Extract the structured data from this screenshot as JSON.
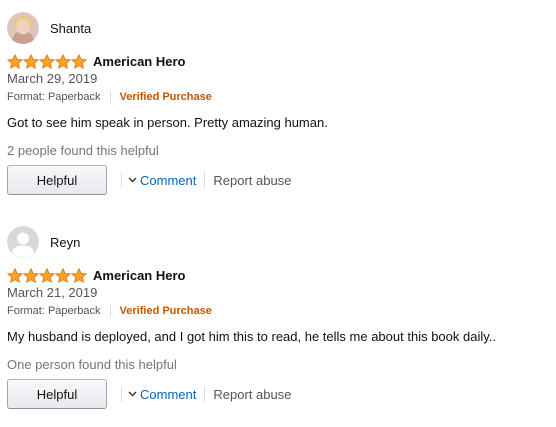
{
  "reviews": [
    {
      "reviewer": "Shanta",
      "avatar": "photo-avatar",
      "rating": 5,
      "title": "American Hero",
      "date": "March 29, 2019",
      "format": "Format: Paperback",
      "verified": "Verified Purchase",
      "text": "Got to see him speak in person. Pretty amazing human.",
      "helpful_count": "2 people found this helpful",
      "helpful_button": "Helpful",
      "comment_label": "Comment",
      "report_label": "Report abuse"
    },
    {
      "reviewer": "Reyn",
      "avatar": "default-avatar",
      "rating": 5,
      "title": "American Hero",
      "date": "March 21, 2019",
      "format": "Format: Paperback",
      "verified": "Verified Purchase",
      "text": "My husband is deployed, and I got him this to read, he tells me about this book daily..",
      "helpful_count": "One person found this helpful",
      "helpful_button": "Helpful",
      "comment_label": "Comment",
      "report_label": "Report abuse"
    }
  ],
  "colors": {
    "star_fill": "#ffa41c",
    "star_stroke": "#de7921",
    "verified": "#c45500",
    "link": "#0066c0",
    "muted": "#555555",
    "helpful_text": "#767676"
  },
  "icons": {
    "star": "star-icon",
    "chevron": "chevron-down-icon"
  }
}
